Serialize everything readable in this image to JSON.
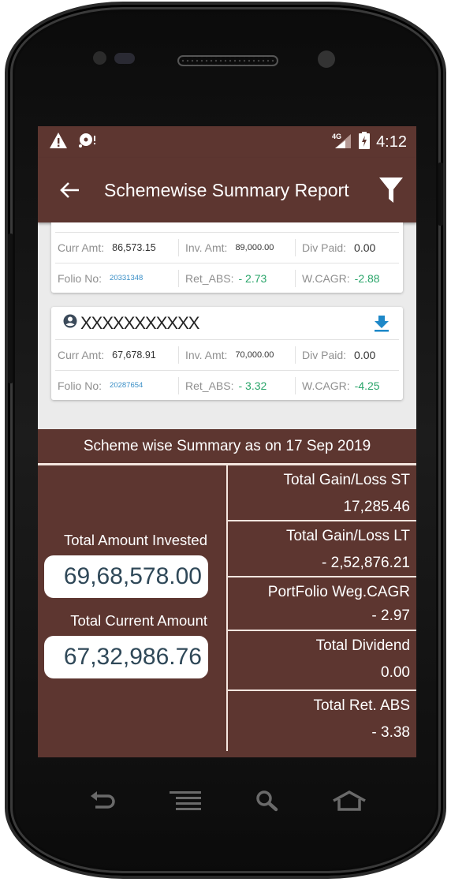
{
  "status_bar": {
    "left_icons": [
      "warning-icon",
      "sync-alert-icon"
    ],
    "network": "4G",
    "time": "4:12"
  },
  "app_bar": {
    "title": "Schemewise Summary Report",
    "back_icon": "arrow-back-icon",
    "filter_icon": "filter-icon"
  },
  "schemes": [
    {
      "investor_name": "",
      "partial": true,
      "curr_amt_label": "Curr Amt:",
      "curr_amt": "86,573.15",
      "inv_amt_label": "Inv. Amt:",
      "inv_amt": "89,000.00",
      "div_paid_label": "Div Paid:",
      "div_paid": "0.00",
      "folio_label": "Folio No:",
      "folio_no": "20331348",
      "ret_abs_label": "Ret_ABS:",
      "ret_abs": "- 2.73",
      "wcagr_label": "W.CAGR:",
      "wcagr": "-2.88"
    },
    {
      "investor_name": "XXXXXXXXXXX",
      "partial": false,
      "curr_amt_label": "Curr Amt:",
      "curr_amt": "67,678.91",
      "inv_amt_label": "Inv. Amt:",
      "inv_amt": "70,000.00",
      "div_paid_label": "Div Paid:",
      "div_paid": "0.00",
      "folio_label": "Folio No:",
      "folio_no": "20287654",
      "ret_abs_label": "Ret_ABS:",
      "ret_abs": "- 3.32",
      "wcagr_label": "W.CAGR:",
      "wcagr": "-4.25"
    }
  ],
  "summary": {
    "title": "Scheme wise Summary as on 17 Sep 2019",
    "total_invested_label": "Total Amount Invested",
    "total_invested": "69,68,578.00",
    "total_current_label": "Total Current Amount",
    "total_current": "67,32,986.76",
    "metrics": [
      {
        "label": "Total Gain/Loss ST",
        "value": "17,285.46"
      },
      {
        "label": "Total Gain/Loss LT",
        "value": "- 2,52,876.21"
      },
      {
        "label": "PortFolio Weg.CAGR",
        "value": "- 2.97"
      },
      {
        "label": "Total Dividend",
        "value": "0.00"
      },
      {
        "label": "Total Ret. ABS",
        "value": "- 3.38"
      }
    ]
  },
  "colors": {
    "primary": "#5d3630",
    "positive_green": "#2aa56a",
    "folio_blue": "#3a8fc7",
    "amount_text": "#2f4858",
    "divider": "#f5e6df"
  },
  "nav_bar": [
    "back-icon",
    "menu-icon",
    "search-icon",
    "home-icon"
  ]
}
